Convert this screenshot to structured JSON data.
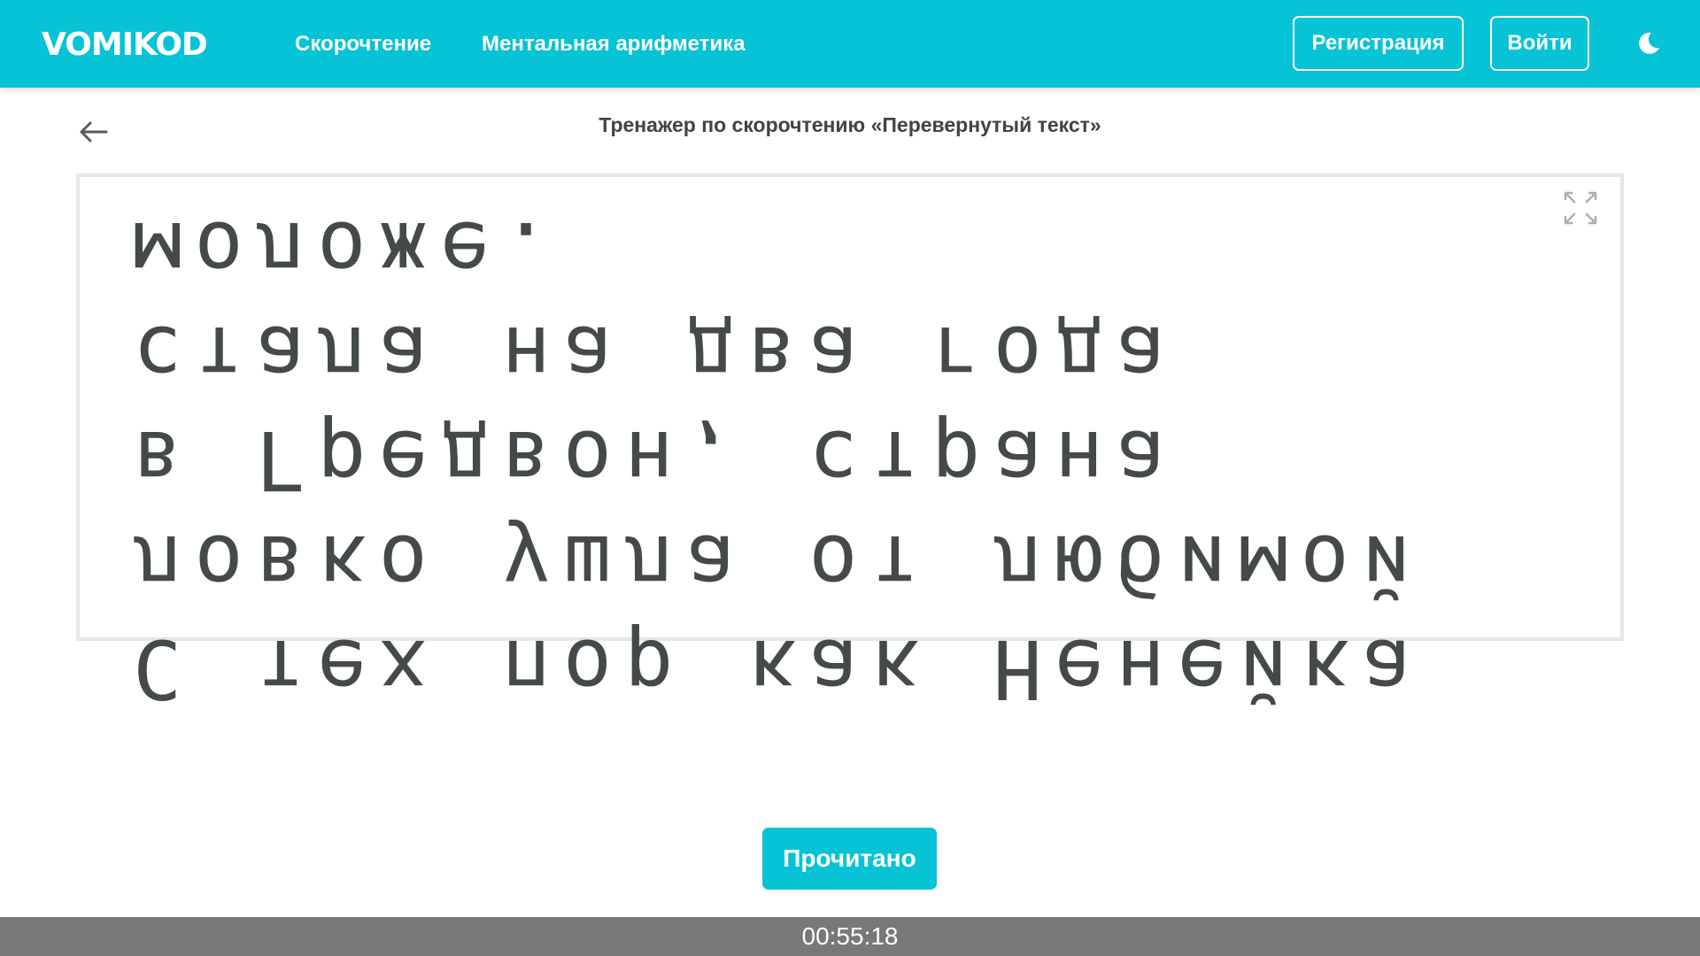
{
  "header": {
    "logo": "VOMIKOD",
    "nav": [
      {
        "label": "Скорочтение"
      },
      {
        "label": "Ментальная арифметика"
      }
    ],
    "register_label": "Регистрация",
    "login_label": "Войти",
    "theme_icon": "moon-icon",
    "accent_color": "#06c3d6"
  },
  "page": {
    "back_icon": "arrow-left-icon",
    "title": "Тренажер по скорочтению «Перевернутый текст»",
    "expand_icon": "expand-icon",
    "reading_text": "С тех пор как Ненейка ловко ушла от любимой в Гредвон, страна стала на два года моложе.",
    "done_label": "Прочитано"
  },
  "timer": {
    "value": "00:55:18"
  }
}
